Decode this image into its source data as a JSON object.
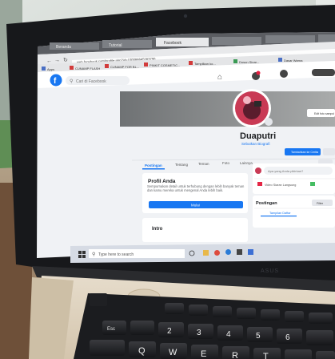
{
  "browser": {
    "tabs": [
      "Beranda",
      "Tutorial",
      "Facebook"
    ],
    "url": "web.facebook.com/profile.php?id=100088645383790",
    "bookmarks": [
      "Apps",
      "CUNAMP FLASH",
      "CUNAMP FOR BL...",
      "PINKIT COSMETIC...",
      "Tampilkan ko...",
      "Dusun Sinar...",
      "Dasar Warna"
    ]
  },
  "facebook": {
    "logo": "f",
    "search_placeholder": "Cari di Facebook",
    "profile_name": "Duaputri",
    "profile_subtitle": "Sebutkan Biografi",
    "add_story_label": "Tambahkan ke Cerita",
    "nav_tabs": [
      "Postingan",
      "Tentang",
      "Teman",
      "Foto",
      "Lainnya"
    ],
    "card_title": "Profil Anda",
    "card_text": "Sempurnakan detail untuk terhubung dengan lebih banyak teman dan kamu mereka untuk mengenal Anda lebih baik.",
    "card_button": "Mulai",
    "intro_title": "Intro",
    "composer_placeholder": "Apa yang Anda pikirkan?",
    "composer_action": "Video Siaran Langsung",
    "posts_title": "Postingan",
    "posts_action": "Filter",
    "list_view_label": "Tampilan Daftar",
    "cover_edit_label": "Edit foto sampul"
  },
  "taskbar": {
    "search_placeholder": "Type here to search"
  },
  "laptop": {
    "brand": "ASUS",
    "keys_row1": [
      "2",
      "3",
      "4",
      "5",
      "6"
    ],
    "keys_row2": [
      "Q",
      "W",
      "E",
      "R",
      "T"
    ],
    "key_esc": "Esc"
  }
}
